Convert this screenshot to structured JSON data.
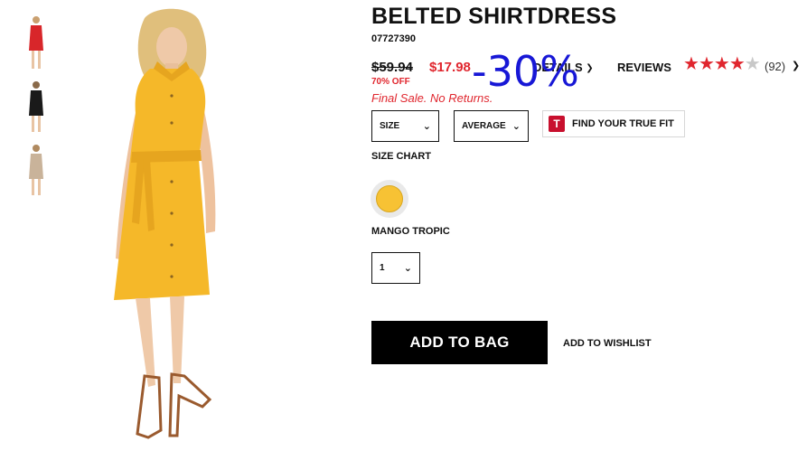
{
  "product": {
    "title": "BELTED SHIRTDRESS",
    "sku": "07727390",
    "price_original": "$59.94",
    "price_sale": "$17.98",
    "percent_off": "70% OFF",
    "final_sale_note": "Final Sale. No Returns.",
    "overlay_discount": "-30%"
  },
  "tabs": {
    "details": "DETAILS",
    "reviews": "REVIEWS",
    "review_count": "(92)",
    "rating": 4,
    "rating_max": 5
  },
  "selectors": {
    "size": "SIZE",
    "fit": "AVERAGE",
    "quantity": "1"
  },
  "truefit": {
    "logo_letter": "T",
    "label": "FIND YOUR TRUE FIT"
  },
  "size_chart_label": "SIZE CHART",
  "color": {
    "name": "MANGO TROPIC",
    "swatch_hex": "#f7c234"
  },
  "actions": {
    "add_to_bag": "ADD TO BAG",
    "add_to_wishlist": "ADD TO WISHLIST"
  },
  "colors": {
    "sale_red": "#e0262e",
    "overlay_blue": "#1717d6",
    "dress_yellow": "#f5b829"
  },
  "icons": {
    "chevron": "chevron-down-icon",
    "star": "star-icon"
  }
}
